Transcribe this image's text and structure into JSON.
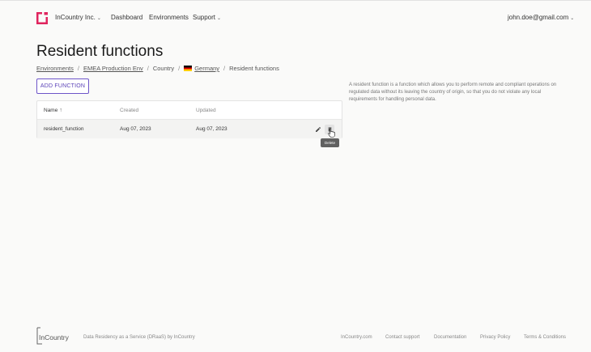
{
  "header": {
    "org_name": "InCountry Inc.",
    "nav": {
      "dashboard": "Dashboard",
      "environments": "Environments",
      "support": "Support"
    },
    "user_email": "john.doe@gmail.com"
  },
  "page": {
    "title": "Resident functions",
    "breadcrumb": [
      "Environments",
      "EMEA Production Env",
      "Country",
      "Germany",
      "Resident functions"
    ],
    "add_button": "ADD FUNCTION",
    "description": "A resident function is a function which allows you to perform remote and compliant operations on regulated data without its leaving the country of origin, so that you do not violate any local requirements for handling personal data."
  },
  "table": {
    "columns": [
      "Name",
      "Created",
      "Updated"
    ],
    "rows": [
      {
        "name": "resident_function",
        "created": "Aug 07, 2023",
        "updated": "Aug 07, 2023"
      }
    ]
  },
  "tooltip": "Delete",
  "footer": {
    "logo_text": "InCountry",
    "tagline": "Data Residency as a Service (DRaaS) by InCountry",
    "links": [
      "InCountry.com",
      "Contact support",
      "Documentation",
      "Privacy Policy",
      "Terms & Conditions"
    ]
  },
  "colors": {
    "brand": "#e0245e",
    "accent": "#5a41b7",
    "tooltip": "#616161"
  },
  "icons": [
    "incountry-logo-icon",
    "chevron-down-icon",
    "arrow-up-icon",
    "germany-flag-icon",
    "edit-icon",
    "delete-icon",
    "hand-cursor-icon"
  ]
}
